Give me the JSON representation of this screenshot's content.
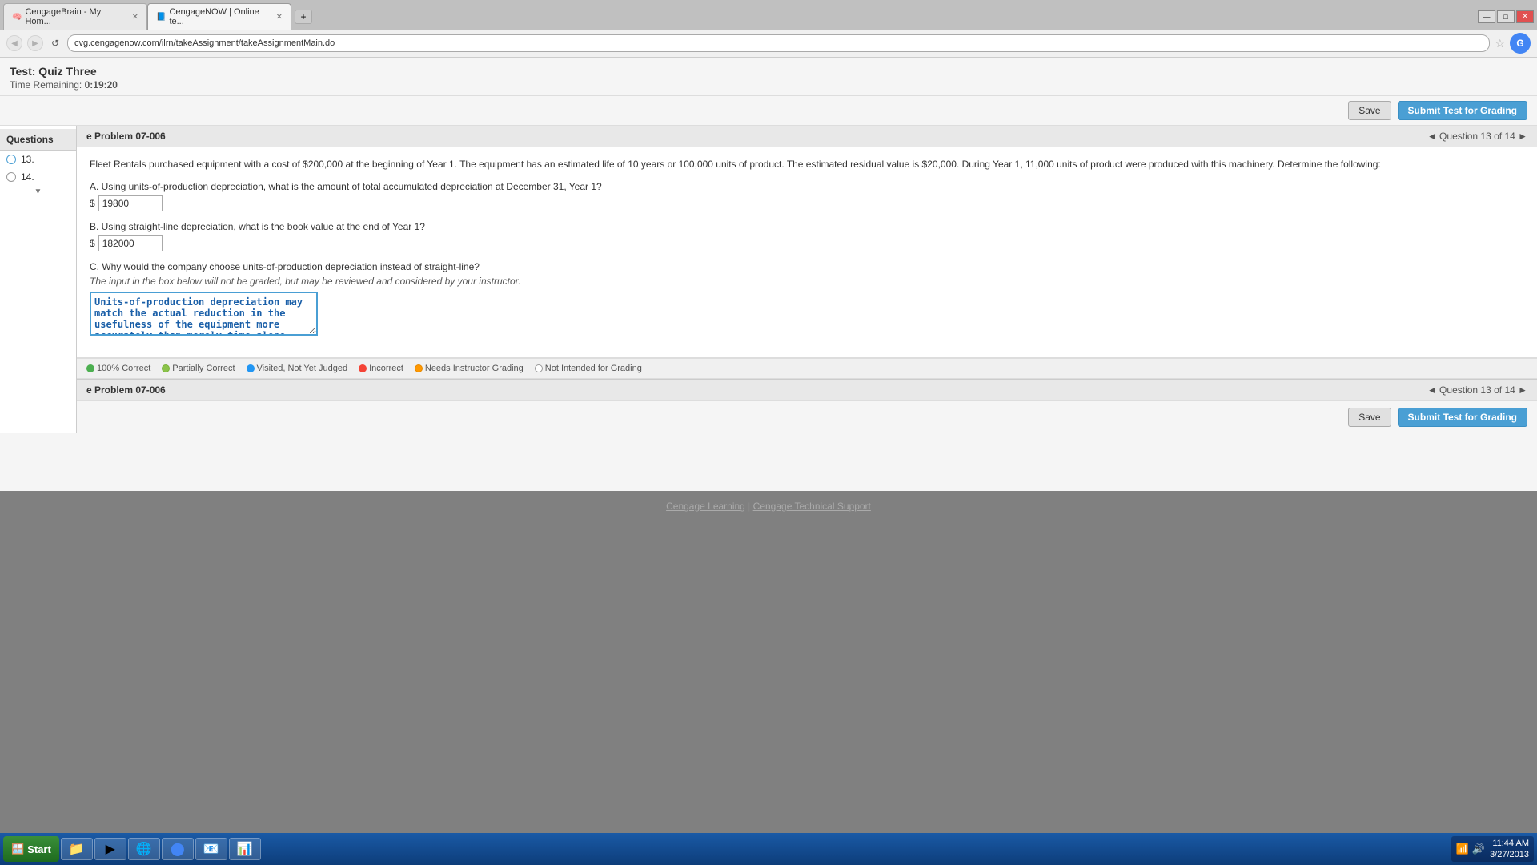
{
  "browser": {
    "tabs": [
      {
        "label": "CengageBrain - My Hom...",
        "active": false,
        "icon": "🧠"
      },
      {
        "label": "CengageNOW | Online te...",
        "active": true,
        "icon": "📘"
      }
    ],
    "url": "cvg.cengagenow.com/ilrn/takeAssignment/takeAssignmentMain.do",
    "new_tab_symbol": "□"
  },
  "window_controls": {
    "minimize": "—",
    "maximize": "□",
    "close": "✕"
  },
  "test": {
    "title": "Test: Quiz Three",
    "time_label": "Time Remaining:",
    "time_value": "0:19:20"
  },
  "toolbar": {
    "save_label": "Save",
    "submit_label": "Submit Test for Grading"
  },
  "sidebar": {
    "header": "Questions",
    "items": [
      {
        "number": "13.",
        "selected": true
      },
      {
        "number": "14.",
        "selected": false
      }
    ]
  },
  "question_header": {
    "problem_label": "e Problem 07-006",
    "nav_text": "◄ Question 13 of 14 ►"
  },
  "question": {
    "intro": "Fleet Rentals purchased equipment with a cost of $200,000 at the beginning of Year 1. The equipment has an estimated life of 10 years or 100,000 units of product. The estimated residual value is $20,000. During Year 1, 11,000 units of product were produced with this machinery. Determine the following:",
    "part_a": {
      "label": "A.  Using units-of-production depreciation, what is the amount of total accumulated depreciation at December 31, Year 1?",
      "currency": "$",
      "value": "19800"
    },
    "part_b": {
      "label": "B.  Using straight-line depreciation, what is the book value at the end of Year 1?",
      "currency": "$",
      "value": "182000"
    },
    "part_c": {
      "label": "C.  Why would the company choose units-of-production depreciation instead of straight-line?",
      "note": "The input in the box below will not be graded, but may be reviewed and considered by your instructor.",
      "textarea_value": "Units-of-production depreciation may match the actual reduction in the usefulness of the equipment more accurately than merely time alone."
    }
  },
  "legend": {
    "items": [
      {
        "dot_class": "dot-correct",
        "label": "100% Correct"
      },
      {
        "dot_class": "dot-partial",
        "label": "Partially Correct"
      },
      {
        "dot_class": "dot-visited",
        "label": "Visited, Not Yet Judged"
      },
      {
        "dot_class": "dot-incorrect",
        "label": "Incorrect"
      },
      {
        "dot_class": "dot-instructor",
        "label": "Needs Instructor Grading"
      },
      {
        "dot_class": "dot-not-intended",
        "label": "Not Intended for Grading"
      }
    ]
  },
  "bottom_bar": {
    "problem_label": "e Problem 07-006",
    "nav_text": "◄ Question 13 of 14 ►"
  },
  "footer": {
    "cengage_learning": "Cengage Learning",
    "separator": " | ",
    "tech_support": "Cengage Technical Support"
  },
  "taskbar": {
    "start_label": "Start",
    "time": "11:44 AM",
    "date": "3/27/2013",
    "taskbar_items": [
      {
        "icon": "🪟",
        "label": "Windows"
      },
      {
        "icon": "📁",
        "label": "File Explorer"
      },
      {
        "icon": "▶",
        "label": "Media"
      },
      {
        "icon": "🌐",
        "label": "IE"
      },
      {
        "icon": "🔵",
        "label": "Chrome"
      },
      {
        "icon": "📧",
        "label": "Outlook"
      },
      {
        "icon": "📊",
        "label": "Excel"
      }
    ]
  }
}
